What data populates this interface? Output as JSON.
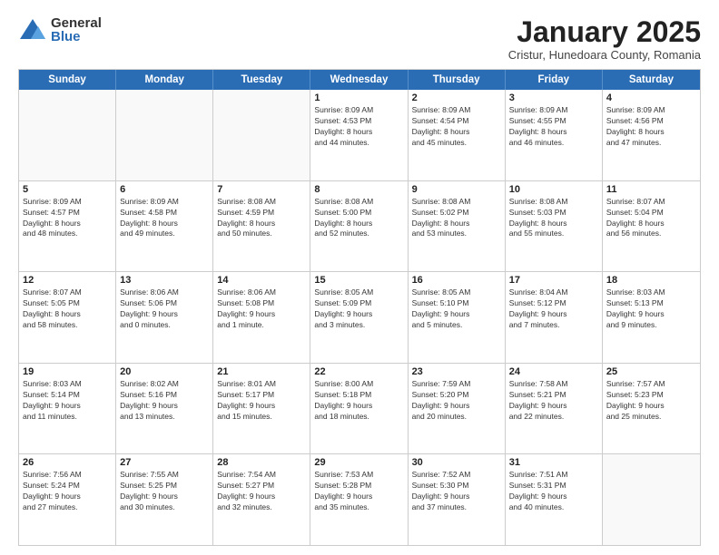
{
  "logo": {
    "general": "General",
    "blue": "Blue"
  },
  "title": "January 2025",
  "subtitle": "Cristur, Hunedoara County, Romania",
  "header_days": [
    "Sunday",
    "Monday",
    "Tuesday",
    "Wednesday",
    "Thursday",
    "Friday",
    "Saturday"
  ],
  "weeks": [
    [
      {
        "day": "",
        "lines": [],
        "empty": true
      },
      {
        "day": "",
        "lines": [],
        "empty": true
      },
      {
        "day": "",
        "lines": [],
        "empty": true
      },
      {
        "day": "1",
        "lines": [
          "Sunrise: 8:09 AM",
          "Sunset: 4:53 PM",
          "Daylight: 8 hours",
          "and 44 minutes."
        ]
      },
      {
        "day": "2",
        "lines": [
          "Sunrise: 8:09 AM",
          "Sunset: 4:54 PM",
          "Daylight: 8 hours",
          "and 45 minutes."
        ]
      },
      {
        "day": "3",
        "lines": [
          "Sunrise: 8:09 AM",
          "Sunset: 4:55 PM",
          "Daylight: 8 hours",
          "and 46 minutes."
        ]
      },
      {
        "day": "4",
        "lines": [
          "Sunrise: 8:09 AM",
          "Sunset: 4:56 PM",
          "Daylight: 8 hours",
          "and 47 minutes."
        ]
      }
    ],
    [
      {
        "day": "5",
        "lines": [
          "Sunrise: 8:09 AM",
          "Sunset: 4:57 PM",
          "Daylight: 8 hours",
          "and 48 minutes."
        ]
      },
      {
        "day": "6",
        "lines": [
          "Sunrise: 8:09 AM",
          "Sunset: 4:58 PM",
          "Daylight: 8 hours",
          "and 49 minutes."
        ]
      },
      {
        "day": "7",
        "lines": [
          "Sunrise: 8:08 AM",
          "Sunset: 4:59 PM",
          "Daylight: 8 hours",
          "and 50 minutes."
        ]
      },
      {
        "day": "8",
        "lines": [
          "Sunrise: 8:08 AM",
          "Sunset: 5:00 PM",
          "Daylight: 8 hours",
          "and 52 minutes."
        ]
      },
      {
        "day": "9",
        "lines": [
          "Sunrise: 8:08 AM",
          "Sunset: 5:02 PM",
          "Daylight: 8 hours",
          "and 53 minutes."
        ]
      },
      {
        "day": "10",
        "lines": [
          "Sunrise: 8:08 AM",
          "Sunset: 5:03 PM",
          "Daylight: 8 hours",
          "and 55 minutes."
        ]
      },
      {
        "day": "11",
        "lines": [
          "Sunrise: 8:07 AM",
          "Sunset: 5:04 PM",
          "Daylight: 8 hours",
          "and 56 minutes."
        ]
      }
    ],
    [
      {
        "day": "12",
        "lines": [
          "Sunrise: 8:07 AM",
          "Sunset: 5:05 PM",
          "Daylight: 8 hours",
          "and 58 minutes."
        ]
      },
      {
        "day": "13",
        "lines": [
          "Sunrise: 8:06 AM",
          "Sunset: 5:06 PM",
          "Daylight: 9 hours",
          "and 0 minutes."
        ]
      },
      {
        "day": "14",
        "lines": [
          "Sunrise: 8:06 AM",
          "Sunset: 5:08 PM",
          "Daylight: 9 hours",
          "and 1 minute."
        ]
      },
      {
        "day": "15",
        "lines": [
          "Sunrise: 8:05 AM",
          "Sunset: 5:09 PM",
          "Daylight: 9 hours",
          "and 3 minutes."
        ]
      },
      {
        "day": "16",
        "lines": [
          "Sunrise: 8:05 AM",
          "Sunset: 5:10 PM",
          "Daylight: 9 hours",
          "and 5 minutes."
        ]
      },
      {
        "day": "17",
        "lines": [
          "Sunrise: 8:04 AM",
          "Sunset: 5:12 PM",
          "Daylight: 9 hours",
          "and 7 minutes."
        ]
      },
      {
        "day": "18",
        "lines": [
          "Sunrise: 8:03 AM",
          "Sunset: 5:13 PM",
          "Daylight: 9 hours",
          "and 9 minutes."
        ]
      }
    ],
    [
      {
        "day": "19",
        "lines": [
          "Sunrise: 8:03 AM",
          "Sunset: 5:14 PM",
          "Daylight: 9 hours",
          "and 11 minutes."
        ]
      },
      {
        "day": "20",
        "lines": [
          "Sunrise: 8:02 AM",
          "Sunset: 5:16 PM",
          "Daylight: 9 hours",
          "and 13 minutes."
        ]
      },
      {
        "day": "21",
        "lines": [
          "Sunrise: 8:01 AM",
          "Sunset: 5:17 PM",
          "Daylight: 9 hours",
          "and 15 minutes."
        ]
      },
      {
        "day": "22",
        "lines": [
          "Sunrise: 8:00 AM",
          "Sunset: 5:18 PM",
          "Daylight: 9 hours",
          "and 18 minutes."
        ]
      },
      {
        "day": "23",
        "lines": [
          "Sunrise: 7:59 AM",
          "Sunset: 5:20 PM",
          "Daylight: 9 hours",
          "and 20 minutes."
        ]
      },
      {
        "day": "24",
        "lines": [
          "Sunrise: 7:58 AM",
          "Sunset: 5:21 PM",
          "Daylight: 9 hours",
          "and 22 minutes."
        ]
      },
      {
        "day": "25",
        "lines": [
          "Sunrise: 7:57 AM",
          "Sunset: 5:23 PM",
          "Daylight: 9 hours",
          "and 25 minutes."
        ]
      }
    ],
    [
      {
        "day": "26",
        "lines": [
          "Sunrise: 7:56 AM",
          "Sunset: 5:24 PM",
          "Daylight: 9 hours",
          "and 27 minutes."
        ]
      },
      {
        "day": "27",
        "lines": [
          "Sunrise: 7:55 AM",
          "Sunset: 5:25 PM",
          "Daylight: 9 hours",
          "and 30 minutes."
        ]
      },
      {
        "day": "28",
        "lines": [
          "Sunrise: 7:54 AM",
          "Sunset: 5:27 PM",
          "Daylight: 9 hours",
          "and 32 minutes."
        ]
      },
      {
        "day": "29",
        "lines": [
          "Sunrise: 7:53 AM",
          "Sunset: 5:28 PM",
          "Daylight: 9 hours",
          "and 35 minutes."
        ]
      },
      {
        "day": "30",
        "lines": [
          "Sunrise: 7:52 AM",
          "Sunset: 5:30 PM",
          "Daylight: 9 hours",
          "and 37 minutes."
        ]
      },
      {
        "day": "31",
        "lines": [
          "Sunrise: 7:51 AM",
          "Sunset: 5:31 PM",
          "Daylight: 9 hours",
          "and 40 minutes."
        ]
      },
      {
        "day": "",
        "lines": [],
        "empty": true
      }
    ]
  ]
}
